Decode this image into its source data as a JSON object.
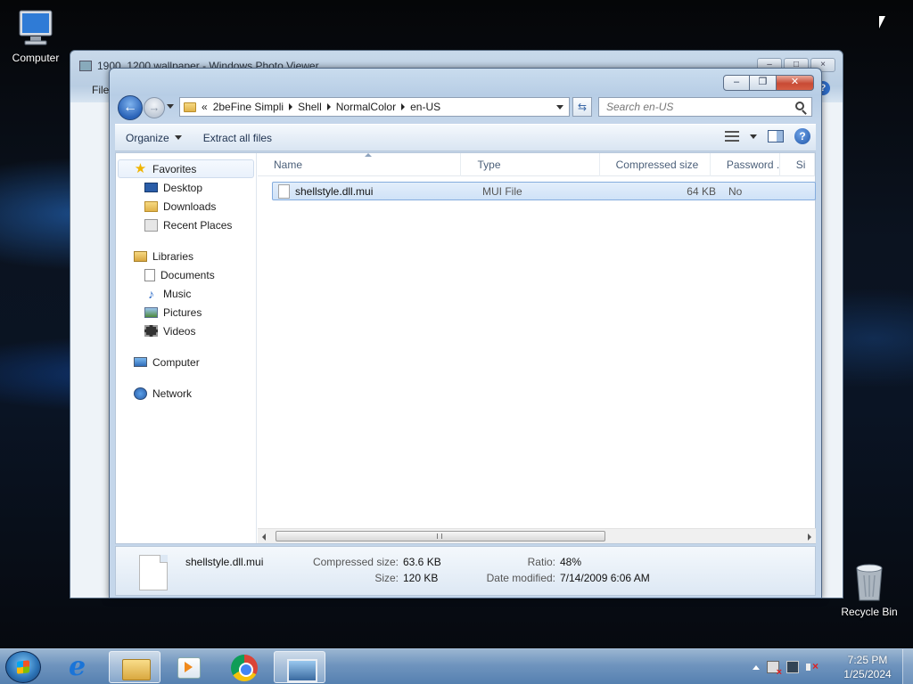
{
  "desktop": {
    "computer_label": "Computer",
    "recycle_label": "Recycle Bin"
  },
  "photo_viewer": {
    "title": "1900_1200 wallpaper - Windows Photo Viewer",
    "menu_file": "File"
  },
  "explorer": {
    "address": {
      "overflow": "«",
      "crumbs": [
        "2beFine Simpli",
        "Shell",
        "NormalColor",
        "en-US"
      ]
    },
    "search_placeholder": "Search en-US",
    "toolbar": {
      "organize": "Organize",
      "extract": "Extract all files"
    },
    "nav": {
      "favorites": "Favorites",
      "desktop": "Desktop",
      "downloads": "Downloads",
      "recent": "Recent Places",
      "libraries": "Libraries",
      "documents": "Documents",
      "music": "Music",
      "pictures": "Pictures",
      "videos": "Videos",
      "computer": "Computer",
      "network": "Network"
    },
    "columns": [
      "Name",
      "Type",
      "Compressed size",
      "Password ...",
      "Si"
    ],
    "files": [
      {
        "name": "shellstyle.dll.mui",
        "type": "MUI File",
        "compressed": "64 KB",
        "password": "No"
      }
    ],
    "details": {
      "filename": "shellstyle.dll.mui",
      "compressed_label": "Compressed size:",
      "compressed_value": "63.6 KB",
      "size_label": "Size:",
      "size_value": "120 KB",
      "ratio_label": "Ratio:",
      "ratio_value": "48%",
      "modified_label": "Date modified:",
      "modified_value": "7/14/2009 6:06 AM"
    }
  },
  "taskbar": {
    "time": "7:25 PM",
    "date": "1/25/2024"
  }
}
